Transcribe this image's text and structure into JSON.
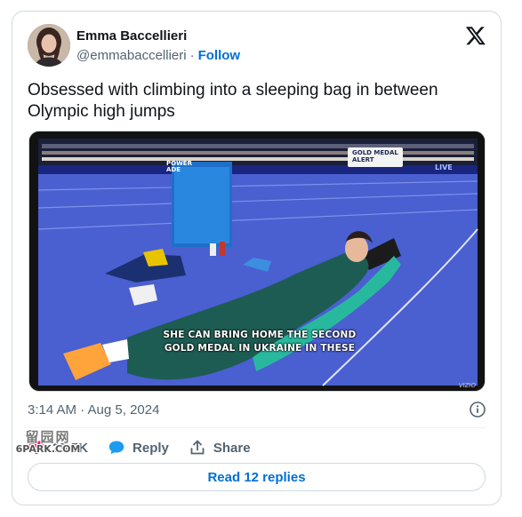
{
  "author": {
    "name": "Emma Baccellieri",
    "handle": "@emmabaccellieri",
    "separator": "·",
    "follow_label": "Follow"
  },
  "brand_icon": "x-logo-icon",
  "tweet": {
    "text": "Obsessed with climbing into a sleeping bag in between Olympic high jumps"
  },
  "media": {
    "caption_line1": "SHE CAN BRING HOME THE SECOND",
    "caption_line2": "GOLD MEDAL IN UKRAINE IN THESE",
    "badge_line1": "GOLD MEDAL",
    "badge_line2": "ALERT",
    "live_label": "LIVE",
    "tv_brand": "VIZIO",
    "bottle_line1": "POWER",
    "bottle_line2": "ADE"
  },
  "meta": {
    "timestamp": "3:14 AM · Aug 5, 2024"
  },
  "actions": {
    "like_count": "25.5K",
    "reply_label": "Reply",
    "share_label": "Share"
  },
  "read_replies_label": "Read 12 replies",
  "watermark": {
    "top": "留园网",
    "bottom": "6PARK.COM"
  },
  "colors": {
    "accent": "#006fd6",
    "secondary_text": "#536471",
    "border": "#cfd9de",
    "like_red": "#f91880"
  }
}
